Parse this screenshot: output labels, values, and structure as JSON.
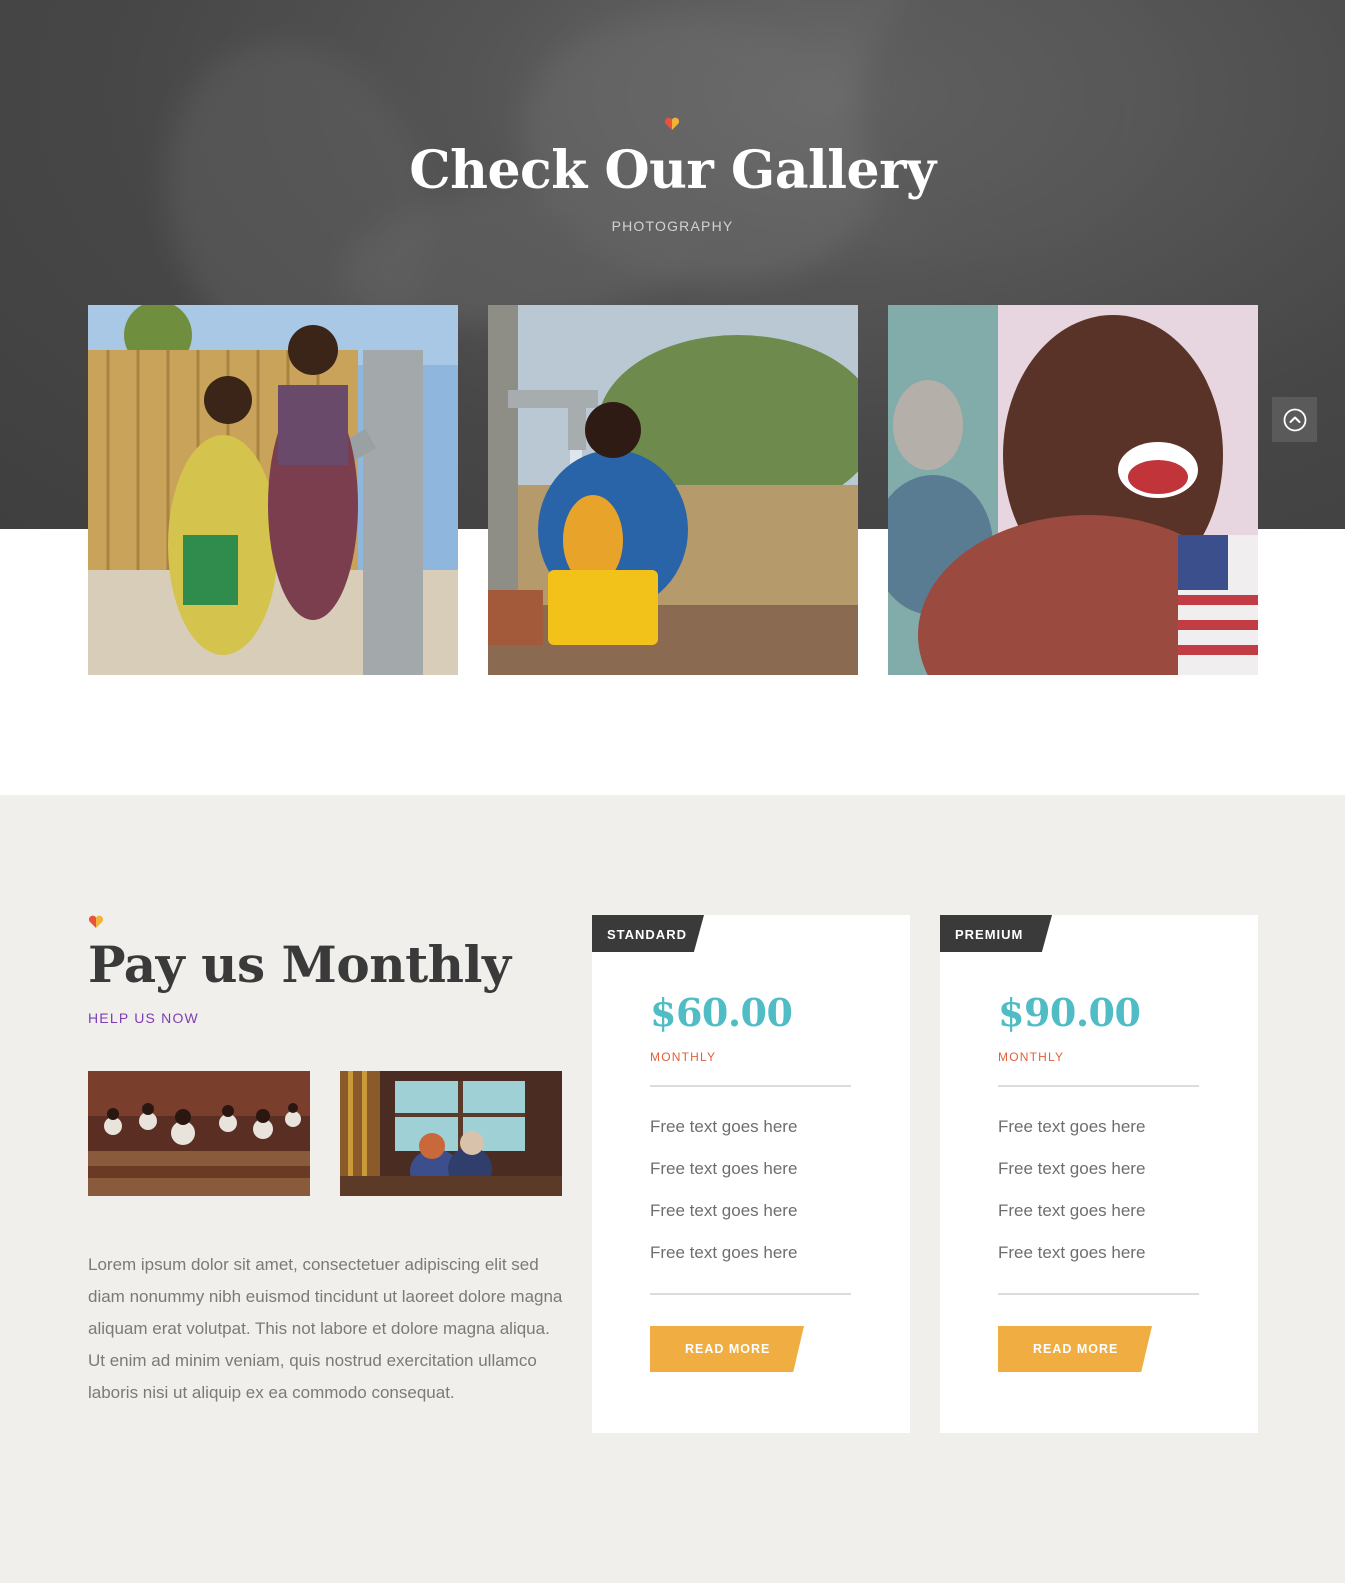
{
  "gallery": {
    "title": "Check Our Gallery",
    "subtitle": "PHOTOGRAPHY",
    "photos": [
      {
        "icon": "children-water-pump-photo"
      },
      {
        "icon": "child-water-tap-photo"
      },
      {
        "icon": "laughing-boy-splash-photo"
      }
    ],
    "scroll_top_icon": "chevron-up-circle-icon"
  },
  "pay": {
    "title": "Pay us Monthly",
    "subtitle": "HELP US NOW",
    "paragraph": "Lorem ipsum dolor sit amet, consectetuer adipiscing elit sed diam nonummy nibh euismod tincidunt ut laoreet dolore magna aliquam erat volutpat. This not labore et dolore magna aliqua. Ut enim ad minim veniam, quis nostrud exercitation ullamco laboris nisi ut aliquip ex ea commodo consequat.",
    "thumbs": [
      {
        "icon": "classroom-photo"
      },
      {
        "icon": "children-reading-photo"
      }
    ]
  },
  "plans": [
    {
      "tag": "STANDARD",
      "price": "$60.00",
      "period": "MONTHLY",
      "features": [
        "Free text goes here",
        "Free text goes here",
        "Free text goes here",
        "Free text goes here"
      ],
      "button": "READ MORE"
    },
    {
      "tag": "PREMIUM",
      "price": "$90.00",
      "period": "MONTHLY",
      "features": [
        "Free text goes here",
        "Free text goes here",
        "Free text goes here",
        "Free text goes here"
      ],
      "button": "READ MORE"
    }
  ],
  "colors": {
    "accent_teal": "#4fbcc6",
    "accent_orange": "#f0ad42",
    "accent_red": "#e0603a",
    "accent_purple": "#7d3fb0",
    "dark": "#3a3a3a",
    "section_bg": "#f1efeb"
  }
}
